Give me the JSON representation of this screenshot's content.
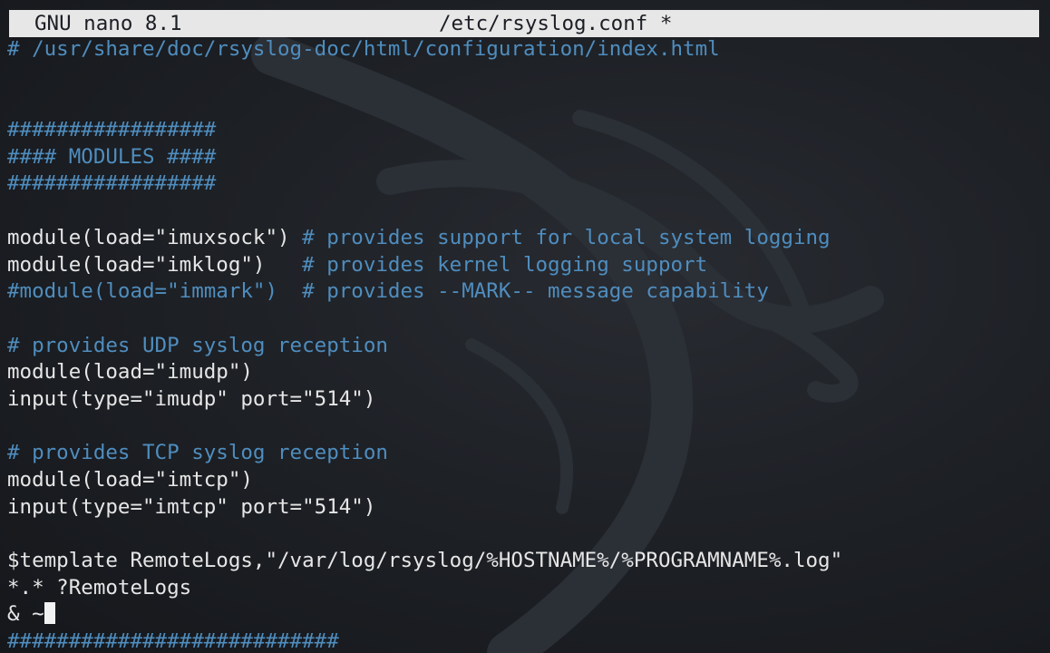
{
  "titlebar": {
    "app": "GNU nano 8.1",
    "filename": "/etc/rsyslog.conf *"
  },
  "colors": {
    "background": "#1b1e24",
    "titlebar_bg": "#e7e7e7",
    "comment": "#4f8dbe",
    "text": "#e6e6e6"
  },
  "editor": {
    "lines": [
      {
        "text": "# /usr/share/doc/rsyslog-doc/html/configuration/index.html",
        "kind": "comment"
      },
      {
        "text": "",
        "kind": "blank"
      },
      {
        "text": "",
        "kind": "blank"
      },
      {
        "text": "#################",
        "kind": "comment"
      },
      {
        "text": "#### MODULES ####",
        "kind": "comment"
      },
      {
        "text": "#################",
        "kind": "comment"
      },
      {
        "text": "",
        "kind": "blank"
      },
      {
        "code": "module(load=\"imuxsock\") ",
        "comment": "# provides support for local system logging",
        "kind": "mixed"
      },
      {
        "code": "module(load=\"imklog\")   ",
        "comment": "# provides kernel logging support",
        "kind": "mixed"
      },
      {
        "text": "#module(load=\"immark\")  # provides --MARK-- message capability",
        "kind": "comment"
      },
      {
        "text": "",
        "kind": "blank"
      },
      {
        "text": "# provides UDP syslog reception",
        "kind": "comment"
      },
      {
        "text": "module(load=\"imudp\")",
        "kind": "code"
      },
      {
        "text": "input(type=\"imudp\" port=\"514\")",
        "kind": "code"
      },
      {
        "text": "",
        "kind": "blank"
      },
      {
        "text": "# provides TCP syslog reception",
        "kind": "comment"
      },
      {
        "text": "module(load=\"imtcp\")",
        "kind": "code"
      },
      {
        "text": "input(type=\"imtcp\" port=\"514\")",
        "kind": "code"
      },
      {
        "text": "",
        "kind": "blank"
      },
      {
        "text": "$template RemoteLogs,\"/var/log/rsyslog/%HOSTNAME%/%PROGRAMNAME%.log\"",
        "kind": "code"
      },
      {
        "text": "*.* ?RemoteLogs",
        "kind": "code"
      },
      {
        "text": "& ~",
        "kind": "code",
        "cursor": true
      },
      {
        "text": "###########################",
        "kind": "comment"
      }
    ]
  }
}
